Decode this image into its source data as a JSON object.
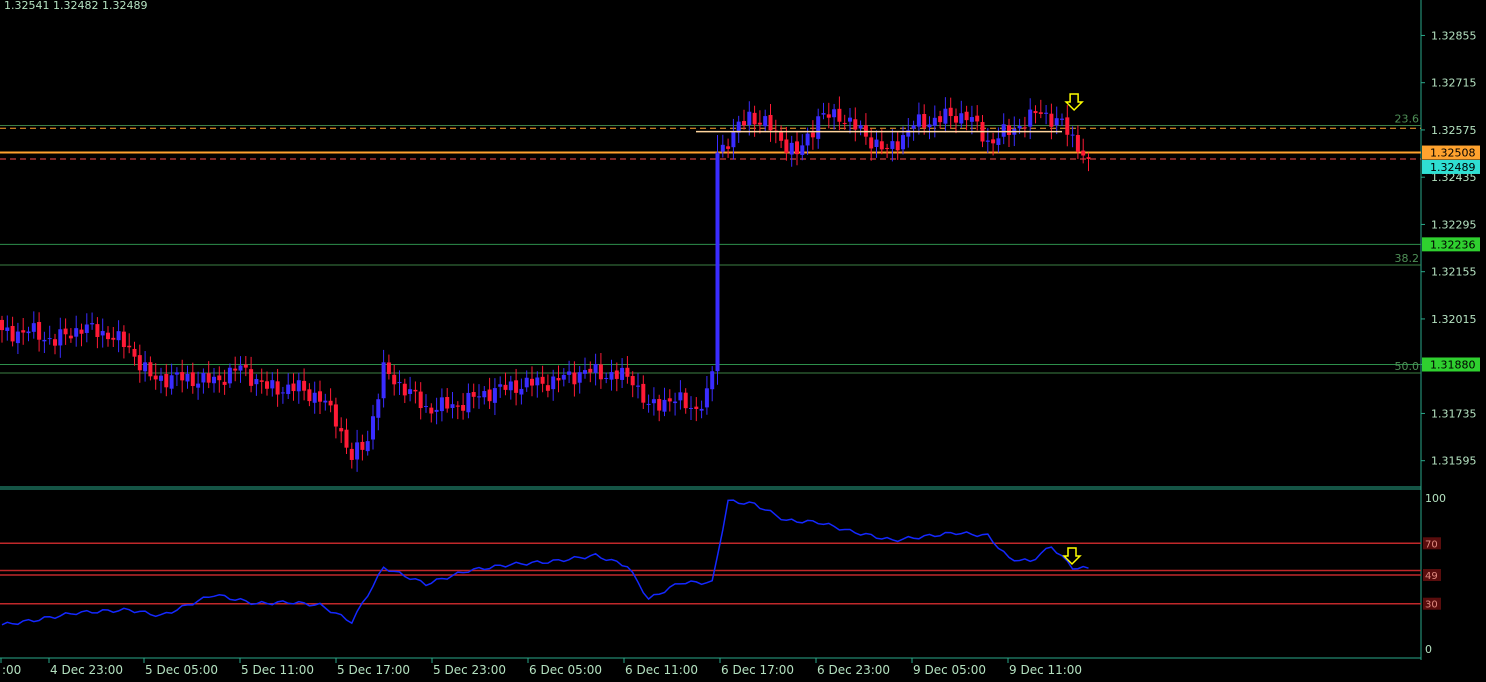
{
  "header": {
    "ohlc_text": "1.32541 1.32482 1.32489"
  },
  "colors": {
    "background": "#000000",
    "bull_candle": "#3a2cff",
    "bear_candle": "#ff1a36",
    "axis": "#2aa88a",
    "axis_text": "#b4e1c0",
    "fib_line": "#3d7f45",
    "support_line": "#2d8f4b",
    "orange_level": "#ffa22e",
    "rsi_line": "#1428ff",
    "rsi_levels": "#c0282a",
    "arrow": "#ffff00"
  },
  "chart_data": [
    {
      "type": "candlestick",
      "price_axis": {
        "ylim": [
          1.3152,
          1.3296
        ],
        "ticks": [
          "1.32855",
          "1.32715",
          "1.32575",
          "1.32435",
          "1.32295",
          "1.32155",
          "1.32015",
          "1.31880",
          "1.31735",
          "1.31595"
        ]
      },
      "time_axis": {
        "labels": [
          ":00",
          "4 Dec 23:00",
          "5 Dec 05:00",
          "5 Dec 11:00",
          "5 Dec 17:00",
          "5 Dec 23:00",
          "6 Dec 05:00",
          "6 Dec 11:00",
          "6 Dec 17:00",
          "6 Dec 23:00",
          "9 Dec 05:00",
          "9 Dec 11:00"
        ]
      },
      "price_labels": [
        {
          "text": "1.32508",
          "value": 1.32508,
          "color": "#ffa22e",
          "text_color": "#000000"
        },
        {
          "text": "1.32489",
          "value": 1.32489,
          "color": "#2fdfd2",
          "text_color": "#000000"
        },
        {
          "text": "1.32236",
          "value": 1.32236,
          "color": "#2fd02f",
          "text_color": "#000000"
        },
        {
          "text": "1.31880",
          "value": 1.3188,
          "color": "#2fd02f",
          "text_color": "#000000"
        }
      ],
      "fib_levels": [
        {
          "label": "23.6",
          "value": 1.32588
        },
        {
          "label": "38.2",
          "value": 1.32175
        },
        {
          "label": "50.0",
          "value": 1.31855
        }
      ],
      "horizontal_lines": [
        {
          "value": 1.3258,
          "color": "#ffa22e",
          "style": "dashed"
        },
        {
          "value": 1.32508,
          "color": "#ffa22e",
          "style": "solid"
        },
        {
          "value": 1.32489,
          "color": "#ff4d4d",
          "style": "dashed"
        },
        {
          "value": 1.32236,
          "color": "#2d8f4b",
          "style": "solid"
        },
        {
          "value": 1.3188,
          "color": "#2d8f4b",
          "style": "solid"
        }
      ],
      "arrow_marker": {
        "bar_index": 157,
        "direction": "down"
      }
    },
    {
      "type": "line",
      "series": [
        {
          "values": []
        }
      ],
      "ylim": [
        0,
        100
      ],
      "ticks": [
        "100",
        "70",
        "49",
        "30",
        "0"
      ],
      "levels": [
        {
          "value": 70,
          "label": "70"
        },
        {
          "value": 52,
          "label": ""
        },
        {
          "value": 49,
          "label": "49"
        },
        {
          "value": 30,
          "label": "30"
        }
      ],
      "arrow_marker": {
        "bar_index": 155,
        "direction": "down"
      }
    }
  ]
}
